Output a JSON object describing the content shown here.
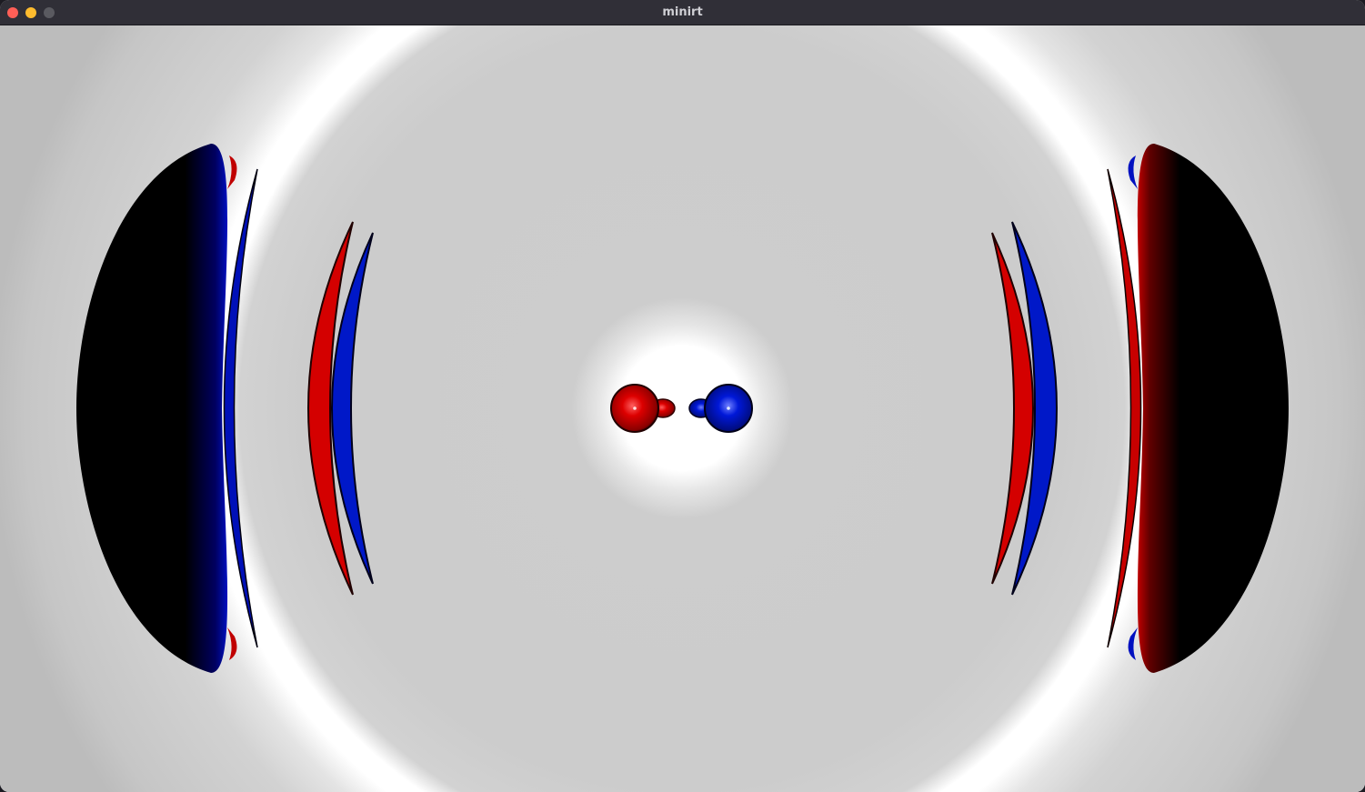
{
  "window": {
    "title": "minirt",
    "controls": {
      "close": "close-icon",
      "minimize": "minimize-icon",
      "zoom": "zoom-icon"
    }
  },
  "scene": {
    "background_color": "#cccccc",
    "glow_color": "#ffffff",
    "shadow_color": "#000000",
    "red_color": "#d40000",
    "blue_color": "#0010c8"
  }
}
